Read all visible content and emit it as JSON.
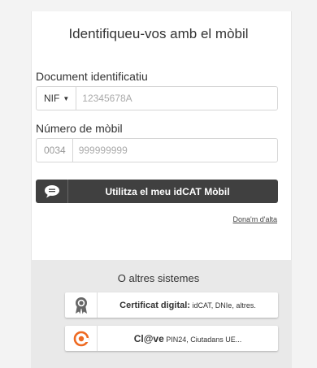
{
  "form": {
    "title": "Identifiqueu-vos amb el mòbil",
    "document_label": "Document identificatiu",
    "document_type": "NIF",
    "document_placeholder": "12345678A",
    "phone_label": "Número de mòbil",
    "phone_prefix": "0034",
    "phone_placeholder": "999999999",
    "submit_label": "Utilitza el meu idCAT Mòbil",
    "signup_link": "Dona'm d'alta"
  },
  "others": {
    "title": "O altres sistemes",
    "certificate": {
      "bold": "Certificat digital:",
      "rest": " idCAT, DNIe, altres."
    },
    "clave": {
      "bold": "Cl@ve",
      "rest": " PIN24, Ciutadans UE..."
    }
  },
  "icons": {
    "submit": "chat-bubble-icon",
    "certificate": "award-ribbon-icon",
    "clave": "clave-at-icon"
  }
}
